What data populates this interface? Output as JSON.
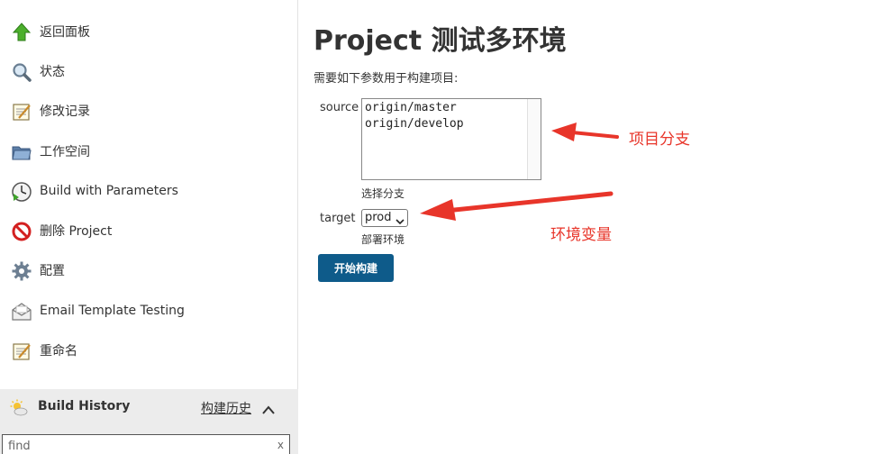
{
  "sidebar": {
    "items": [
      {
        "label": "返回面板",
        "icon": "up-arrow-icon"
      },
      {
        "label": "状态",
        "icon": "magnifier-icon"
      },
      {
        "label": "修改记录",
        "icon": "notepad-icon"
      },
      {
        "label": "工作空间",
        "icon": "folder-icon"
      },
      {
        "label": "Build with Parameters",
        "icon": "clock-play-icon"
      },
      {
        "label": "删除 Project",
        "icon": "no-entry-icon"
      },
      {
        "label": "配置",
        "icon": "gear-icon"
      },
      {
        "label": "Email Template Testing",
        "icon": "envelope-icon"
      },
      {
        "label": "重命名",
        "icon": "notepad-icon"
      }
    ]
  },
  "build_history": {
    "title": "Build History",
    "link": "构建历史",
    "search_placeholder": "find",
    "clear": "x"
  },
  "main": {
    "title": "Project 测试多环境",
    "description": "需要如下参数用于构建项目:",
    "params": {
      "source": {
        "label": "source",
        "options": [
          "origin/master",
          "origin/develop"
        ],
        "hint": "选择分支"
      },
      "target": {
        "label": "target",
        "selected": "prod",
        "hint": "部署环境"
      }
    },
    "build_button": "开始构建"
  },
  "annotations": {
    "branch": "项目分支",
    "env": "环境变量",
    "color": "#e8352a"
  },
  "colors": {
    "accent": "#0e5b8a",
    "panel": "#ececec"
  }
}
